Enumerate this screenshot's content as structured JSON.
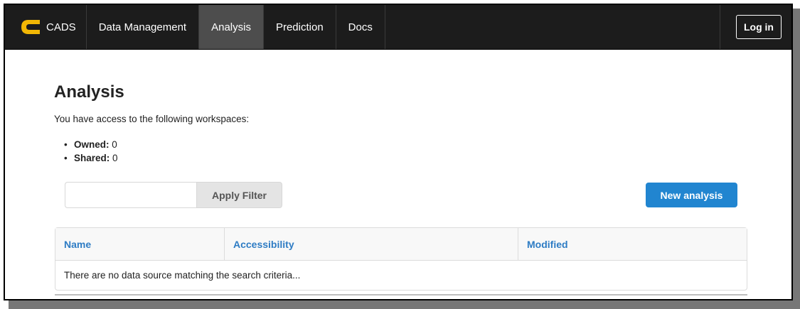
{
  "nav": {
    "brand": "CADS",
    "items": [
      {
        "label": "Data Management",
        "active": false
      },
      {
        "label": "Analysis",
        "active": true
      },
      {
        "label": "Prediction",
        "active": false
      },
      {
        "label": "Docs",
        "active": false
      }
    ],
    "login_label": "Log in"
  },
  "main": {
    "title": "Analysis",
    "intro": "You have access to the following workspaces:",
    "workspaces": [
      {
        "label": "Owned:",
        "value": "0"
      },
      {
        "label": "Shared:",
        "value": "0"
      }
    ],
    "filter": {
      "value": "",
      "placeholder": "",
      "button_label": "Apply Filter"
    },
    "new_button_label": "New analysis",
    "table": {
      "columns": [
        "Name",
        "Accessibility",
        "Modified"
      ],
      "empty_message": "There are no data source matching the search criteria..."
    }
  },
  "colors": {
    "navbar": "#1c1c1c",
    "nav_active": "#4d4d4d",
    "accent": "#2185d0",
    "header_text": "#2e7cc4",
    "logo": "#f2b705"
  },
  "icons": {
    "brand_logo": "cads-logo-icon"
  }
}
